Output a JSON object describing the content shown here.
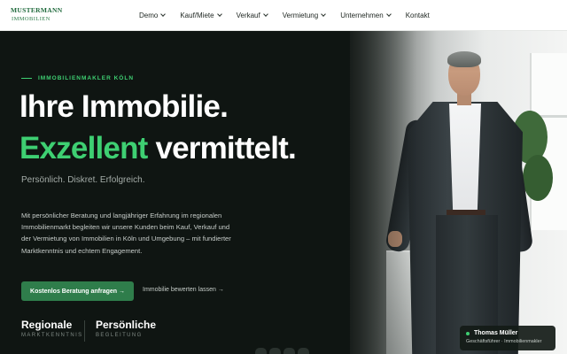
{
  "logo": {
    "top": "MUSTERMANN",
    "bottom": "IMMOBILIEN"
  },
  "nav": {
    "items": [
      {
        "label": "Demo",
        "dropdown": true
      },
      {
        "label": "Kauf/Miete",
        "dropdown": true
      },
      {
        "label": "Verkauf",
        "dropdown": true
      },
      {
        "label": "Vermietung",
        "dropdown": true
      },
      {
        "label": "Unternehmen",
        "dropdown": true
      },
      {
        "label": "Kontakt",
        "dropdown": false
      }
    ]
  },
  "hero": {
    "eyebrow": "IMMOBILIENMAKLER KÖLN",
    "headline_1": "Ihre Immobilie.",
    "headline_2_accent": "Exzellent",
    "headline_2_rest": " vermittelt.",
    "tagline": "Persönlich. Diskret. Erfolgreich.",
    "description": "Mit persönlicher Beratung und langjähriger Erfahrung im regionalen Immobilienmarkt begleiten wir unsere Kunden beim Kauf, Verkauf und der Vermietung von Immobilien in Köln und Umgebung – mit fundierter Marktkenntnis und echtem Engagement.",
    "cta_primary": "Kostenlos Beratung anfragen →",
    "cta_secondary": "Immobilie bewerten lassen →",
    "stats": [
      {
        "title": "Regionale",
        "subtitle": "MARKTKENNTNIS"
      },
      {
        "title": "Persönliche",
        "subtitle": "BEGLEITUNG"
      }
    ],
    "caption": {
      "name": "Thomas Müller",
      "role": "Geschäftsführer · Immobilienmakler"
    }
  },
  "colors": {
    "accent": "#3ecf72",
    "button": "#2f7d4b",
    "background": "#0f1512",
    "brand": "#1f6a3c"
  }
}
